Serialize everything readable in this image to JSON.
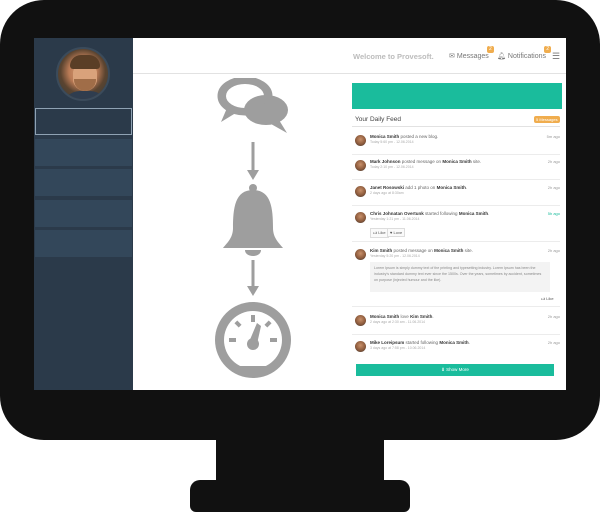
{
  "header": {
    "welcome": "Welcome to Provesoft.",
    "messages_label": "Messages",
    "messages_count": "2",
    "notifications_label": "Notifications",
    "notifications_count": "2"
  },
  "feed": {
    "title": "Your Daily Feed",
    "badge": "5 Messages",
    "items": [
      {
        "author": "Monica Smith",
        "action": "posted a new blog.",
        "time": "5m ago",
        "date": "Today 5:60 pm - 12.06.2014"
      },
      {
        "author": "Mark Johnson",
        "action": "posted message on",
        "target": "Monica Smith",
        "tail": "site.",
        "time": "2h ago",
        "date": "Today 2:10 pm - 12.06.2014"
      },
      {
        "author": "Janet Rosowski",
        "action": "add 1 photo on",
        "target": "Monica Smith",
        "tail": ".",
        "time": "2h ago",
        "date": "2 days ago at 8:30am"
      },
      {
        "author": "Chris Johnatan Overtunk",
        "action": "started following",
        "target": "Monica Smith",
        "tail": ".",
        "time": "5h ago",
        "date": "Yesterday 1:21 pm - 11.06.2014",
        "like": "Like",
        "love": "Love"
      },
      {
        "author": "Kim Smith",
        "action": "posted message on",
        "target": "Monica Smith",
        "tail": "site.",
        "time": "2h ago",
        "date": "Yesterday 5:20 pm - 12.06.2014",
        "quote": "Lorem Ipsum is simply dummy text of the printing and typesetting industry. Lorem Ipsum has been the industry's standard dummy text ever since the 1500s. Over the years, sometimes by accident, sometimes on purpose (injected humour and the like).",
        "like": "Like"
      },
      {
        "author": "Monica Smith",
        "action": "love",
        "target": "Kim Smith",
        "tail": ".",
        "time": "2h ago",
        "date": "2 days ago at 2:30 am - 11.06.2014"
      },
      {
        "author": "Mike Loreipsum",
        "action": "started following",
        "target": "Monica Smith",
        "tail": ".",
        "time": "2h ago",
        "date": "3 days ago at 7:58 pm - 10.06.2014"
      }
    ],
    "show_more": "Show More"
  },
  "colors": {
    "accent": "#1abc9c",
    "sidebar": "#2b3a4a",
    "badge": "#f0ad4e",
    "flow_icons": "#9e9e9e"
  },
  "icons": [
    "chat-bubbles-icon",
    "bell-icon",
    "gauge-icon",
    "envelope-icon",
    "bell-small-icon",
    "menu-icon"
  ]
}
